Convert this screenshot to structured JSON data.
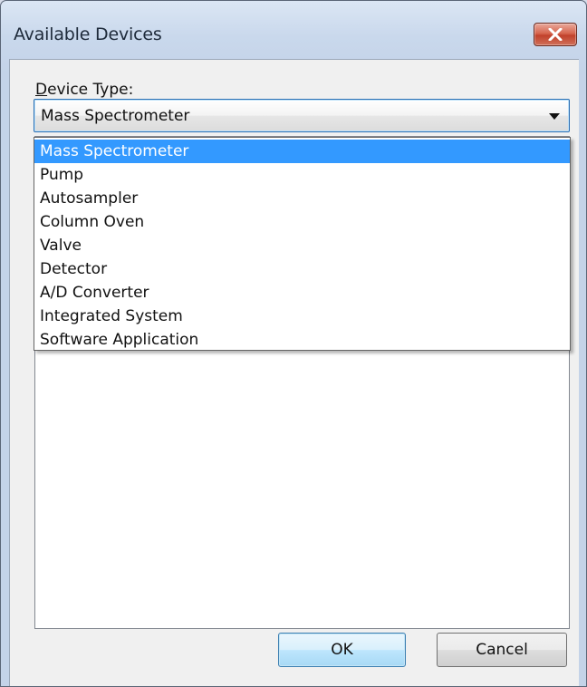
{
  "window": {
    "title": "Available Devices"
  },
  "device_type": {
    "label_prefix": "D",
    "label_rest": "evice Type:",
    "selected_value": "Mass Spectrometer",
    "options": [
      "Mass Spectrometer",
      "Pump",
      "Autosampler",
      "Column Oven",
      "Valve",
      "Detector",
      "A/D Converter",
      "Integrated System",
      "Software Application"
    ],
    "highlighted_option": "Mass Spectrometer"
  },
  "buttons": {
    "ok_label": "OK",
    "cancel_label": "Cancel"
  },
  "icons": {
    "close": "close-icon",
    "dropdown": "chevron-down-icon"
  },
  "colors": {
    "selection": "#3399ff",
    "close_button": "#c1412b"
  }
}
